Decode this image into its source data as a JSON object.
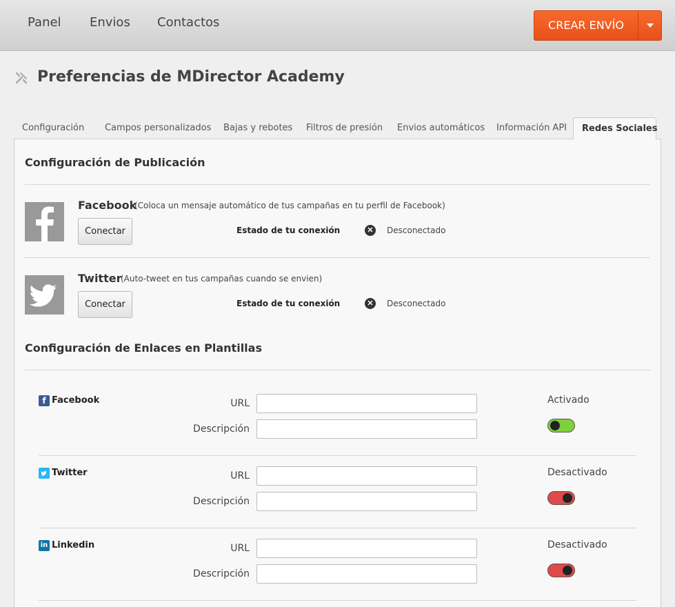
{
  "nav": {
    "items": [
      "Panel",
      "Envios",
      "Contactos"
    ],
    "create_label": "CREAR ENVÍO"
  },
  "page": {
    "title": "Preferencias de MDirector Academy"
  },
  "tabs": [
    {
      "label": "Configuración"
    },
    {
      "label": "Campos personalizados"
    },
    {
      "label": "Bajas y rebotes"
    },
    {
      "label": "Filtros de presión"
    },
    {
      "label": "Envios automáticos"
    },
    {
      "label": "Información API"
    },
    {
      "label": "Redes Sociales",
      "active": true
    }
  ],
  "publication": {
    "title": "Configuración de Publicación",
    "networks": [
      {
        "name": "Facebook",
        "description": "(Coloca un mensaje automático de tus campañas en tu perfil de Facebook)",
        "connect_label": "Conectar",
        "status_label": "Estado de tu conexión",
        "status": "Desconectado",
        "icon": "facebook-icon"
      },
      {
        "name": "Twitter",
        "description": "(Auto-tweet en tus campañas cuando se envien)",
        "connect_label": "Conectar",
        "status_label": "Estado de tu conexión",
        "status": "Desconectado",
        "icon": "twitter-icon"
      }
    ]
  },
  "links": {
    "title": "Configuración de Enlaces en Plantillas",
    "url_label": "URL",
    "description_label": "Descripción",
    "items": [
      {
        "name": "Facebook",
        "state": "Activado",
        "enabled": true,
        "icon": "facebook-icon",
        "color": "#3b5998",
        "url": "",
        "description": ""
      },
      {
        "name": "Twitter",
        "state": "Desactivado",
        "enabled": false,
        "icon": "twitter-icon",
        "color": "#29b6f6",
        "url": "",
        "description": ""
      },
      {
        "name": "Linkedin",
        "state": "Desactivado",
        "enabled": false,
        "icon": "linkedin-icon",
        "color": "#0e76a8",
        "url": "",
        "description": ""
      }
    ]
  },
  "colors": {
    "accent": "#f05a22",
    "toggle_on": "#7fd13b",
    "toggle_off": "#e14a4a"
  }
}
